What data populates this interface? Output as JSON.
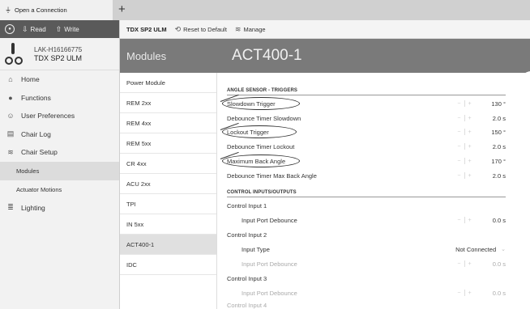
{
  "tab": {
    "title": "Open a Connection",
    "icon": "plug-icon",
    "new_tab": "+"
  },
  "sidebar_top": {
    "read_label": "Read",
    "write_label": "Write"
  },
  "device": {
    "id": "LAK-H16166775",
    "model": "TDX SP2 ULM"
  },
  "nav": {
    "home": "Home",
    "functions": "Functions",
    "user_preferences": "User Preferences",
    "chair_log": "Chair Log",
    "chair_setup": "Chair Setup",
    "modules": "Modules",
    "actuator_motions": "Actuator Motions",
    "lighting": "Lighting"
  },
  "toolbar": {
    "device": "TDX SP2 ULM",
    "reset_label": "Reset to Default",
    "manage_label": "Manage"
  },
  "modules_header": "Modules",
  "modules": [
    "Power Module",
    "REM 2xx",
    "REM 4xx",
    "REM 5xx",
    "CR 4xx",
    "ACU 2xx",
    "TPI",
    "IN 5xx",
    "ACT400-1",
    "IDC"
  ],
  "active_module": "ACT400-1",
  "main": {
    "title": "ACT400-1",
    "section_triggers": "ANGLE SENSOR - TRIGGERS",
    "triggers": [
      {
        "label": "Slowdown Trigger",
        "value": "130 °"
      },
      {
        "label": "Debounce Timer Slowdown",
        "value": "2.0 s"
      },
      {
        "label": "Lockout Trigger",
        "value": "150 °"
      },
      {
        "label": "Debounce Timer Lockout",
        "value": "2.0 s"
      },
      {
        "label": "Maximum Back Angle",
        "value": "170 °"
      },
      {
        "label": "Debounce Timer Max Back Angle",
        "value": "2.0 s"
      }
    ],
    "section_io": "CONTROL INPUTS/OUTPUTS",
    "io": {
      "ci1": "Control Input 1",
      "ci1_debounce": {
        "label": "Input Port Debounce",
        "value": "0.0 s"
      },
      "ci2": "Control Input 2",
      "ci2_type": {
        "label": "Input Type",
        "value": "Not Connected"
      },
      "ci2_debounce": {
        "label": "Input Port Debounce",
        "value": "0.0 s"
      },
      "ci3": "Control Input 3",
      "ci3_debounce": {
        "label": "Input Port Debounce",
        "value": "0.0 s"
      },
      "ci4": "Control Input 4"
    }
  }
}
